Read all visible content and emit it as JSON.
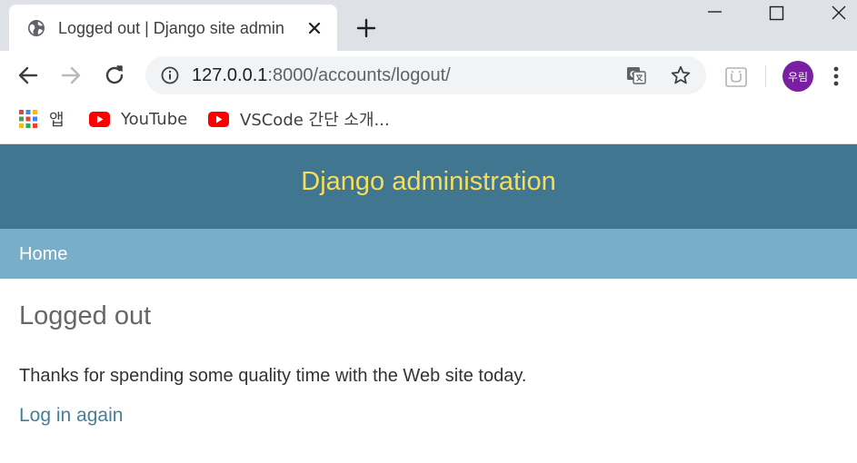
{
  "browser": {
    "tab": {
      "title": "Logged out | Django site admin"
    },
    "address_bar": {
      "host": "127.0.0.1",
      "rest": ":8000/accounts/logout/"
    },
    "profile": {
      "initials": "우림",
      "color": "#7b1fa2"
    },
    "bookmarks": [
      {
        "label": "앱",
        "icon": "apps-icon"
      },
      {
        "label": "YouTube",
        "icon": "youtube-icon"
      },
      {
        "label": "VSCode 간단 소개...",
        "icon": "youtube-icon"
      }
    ]
  },
  "page": {
    "branding": "Django administration",
    "breadcrumb_home": "Home",
    "title": "Logged out",
    "message": "Thanks for spending some quality time with the Web site today.",
    "login_link": "Log in again",
    "colors": {
      "header": "#417690",
      "brand_text": "#f5dd5d",
      "breadcrumbs": "#79aec8",
      "link": "#447e9b"
    }
  }
}
